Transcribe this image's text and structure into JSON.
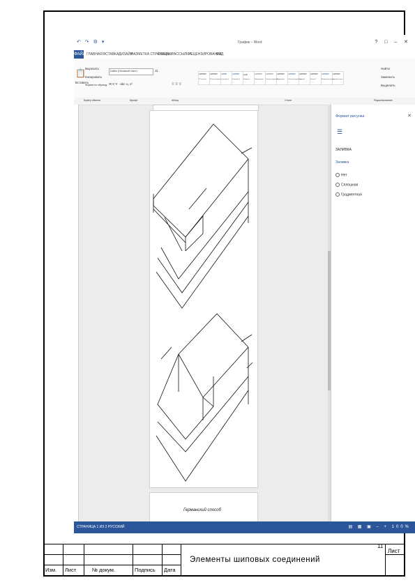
{
  "screenshot": {
    "quick_access": "↶ ↷ ⚙ ▾",
    "doc_title": "График – Word",
    "window_controls": "? □ – ✕",
    "file_tab": "ФАЙЛ",
    "menu": [
      "ГЛАВНАЯ",
      "ВСТАВКА",
      "ДИЗАЙН",
      "РАЗМЕТКА СТРАНИЦЫ",
      "ССЫЛКИ",
      "РАССЫЛКИ",
      "РЕЦЕНЗИРОВАНИЕ",
      "ВИД"
    ],
    "ribbon": {
      "paste": "Вставить",
      "cut": "Вырезать",
      "copy": "Копировать",
      "format_painter": "Формат по образцу",
      "font_name": "Calibri (Основной текст)",
      "font_size": "11",
      "format_row": "Ж К Ч · abc x₂ x²",
      "styles": [
        "АаБбВвГг",
        "АаБбВвГг",
        "АаБбВ",
        "АаБбВвГ",
        "АаБ",
        "АаБбВвГг",
        "АаБбВвГг",
        "АаБбВвГг",
        "АаБбВвГг",
        "АаБбВвГг",
        "АаБбВвГг",
        "АаБбВвГг",
        "АаБбВвГг"
      ],
      "style_names": [
        "¶ Обычный",
        "¶ Без интервала",
        "Заголовок 1",
        "Заголовок 2",
        "Название",
        "Подзаголовок",
        "Слабое выделение",
        "Выделение",
        "Сильное выделение",
        "Строгий",
        "Цитата 2",
        "Выделенная цитата",
        "Слабая ссылка"
      ],
      "find": "Найти",
      "replace": "Заменить",
      "select": "Выделить"
    },
    "ribbon_groups": [
      "Буфер обмена",
      "Шрифт",
      "Абзац",
      "Стили",
      "Редактирование"
    ],
    "page2_caption": "Германский способ",
    "pane": {
      "title": "Формат рисунка",
      "icon": "☰",
      "section": "ЗАЛИВКА",
      "subsection": "Заливка",
      "options": [
        "Нет",
        "Сплошная",
        "Градиентная"
      ]
    },
    "status": "СТРАНИЦА 1 ИЗ 2   РУССКИЙ",
    "status_right": "▤ ▦ ▣ – + 100%"
  },
  "title_block": {
    "sheet_number": "11",
    "sheet_label": "Лист",
    "doc_title": "Элементы шиповых соединений",
    "columns": [
      "Изм.",
      "Лист",
      "№ докум.",
      "Подпись",
      "Дата"
    ]
  }
}
